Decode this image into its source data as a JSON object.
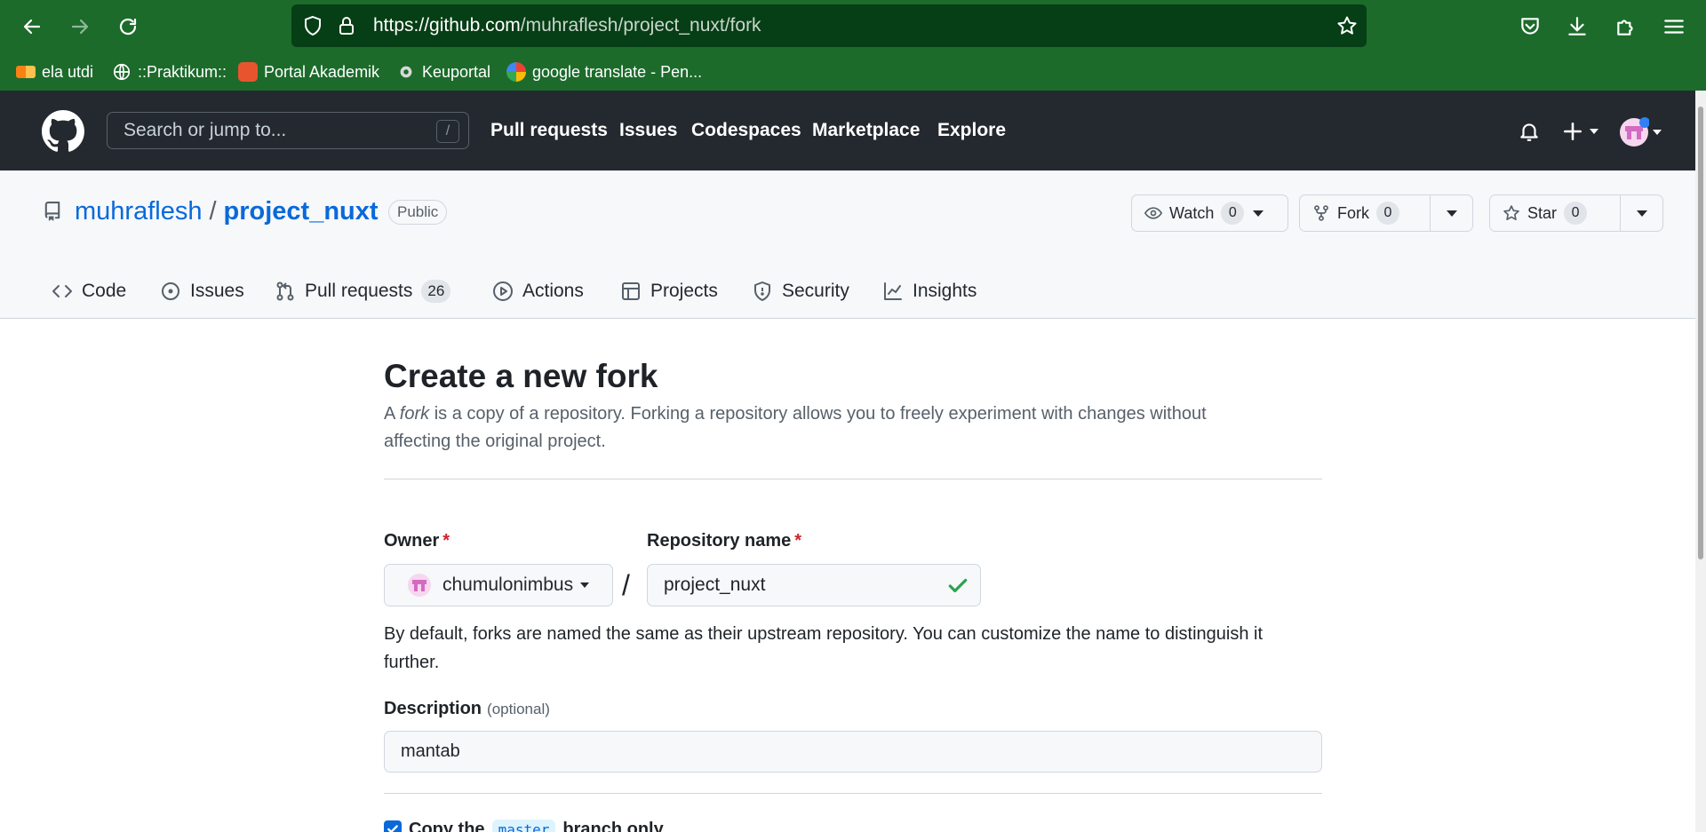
{
  "browser": {
    "url_host": "https://github.com",
    "url_path": "/muhraflesh/project_nuxt/fork",
    "bookmarks": [
      {
        "label": "ela utdi",
        "icon": "moodle-icon"
      },
      {
        "label": "::Praktikum::",
        "icon": "globe-icon"
      },
      {
        "label": "Portal Akademik",
        "icon": "portal-icon"
      },
      {
        "label": "Keuportal",
        "icon": "gear-icon"
      },
      {
        "label": "google translate - Pen...",
        "icon": "google-icon"
      }
    ]
  },
  "gh_header": {
    "search_placeholder": "Search or jump to...",
    "search_shortcut": "/",
    "nav": [
      "Pull requests",
      "Issues",
      "Codespaces",
      "Marketplace",
      "Explore"
    ]
  },
  "repo": {
    "owner": "muhraflesh",
    "separator": "/",
    "name": "project_nuxt",
    "visibility": "Public",
    "watch": {
      "label": "Watch",
      "count": "0"
    },
    "fork": {
      "label": "Fork",
      "count": "0"
    },
    "star": {
      "label": "Star",
      "count": "0"
    },
    "tabs": [
      {
        "label": "Code",
        "icon": "code-icon"
      },
      {
        "label": "Issues",
        "icon": "issue-icon"
      },
      {
        "label": "Pull requests",
        "icon": "pull-request-icon",
        "count": "26"
      },
      {
        "label": "Actions",
        "icon": "play-icon"
      },
      {
        "label": "Projects",
        "icon": "table-icon"
      },
      {
        "label": "Security",
        "icon": "shield-icon"
      },
      {
        "label": "Insights",
        "icon": "graph-icon"
      }
    ]
  },
  "form": {
    "title": "Create a new fork",
    "subtitle_pre": "A ",
    "subtitle_em": "fork",
    "subtitle_post": " is a copy of a repository. Forking a repository allows you to freely experiment with changes without affecting the original project.",
    "owner_label": "Owner",
    "required_mark": "*",
    "owner_value": "chumulonimbus",
    "slash": "/",
    "repo_name_label": "Repository name",
    "repo_name_value": "project_nuxt",
    "hint": "By default, forks are named the same as their upstream repository. You can customize the name to distinguish it further.",
    "description_label": "Description",
    "description_optional": "(optional)",
    "description_value": "mantab",
    "copy_pre": "Copy the",
    "copy_branch": "master",
    "copy_post": "branch only",
    "copy_checked": true
  },
  "colors": {
    "browser_chrome": "#1c6b2b",
    "github_header": "#24292f",
    "link": "#0969da",
    "required": "#cf222e",
    "success": "#2da44e"
  }
}
